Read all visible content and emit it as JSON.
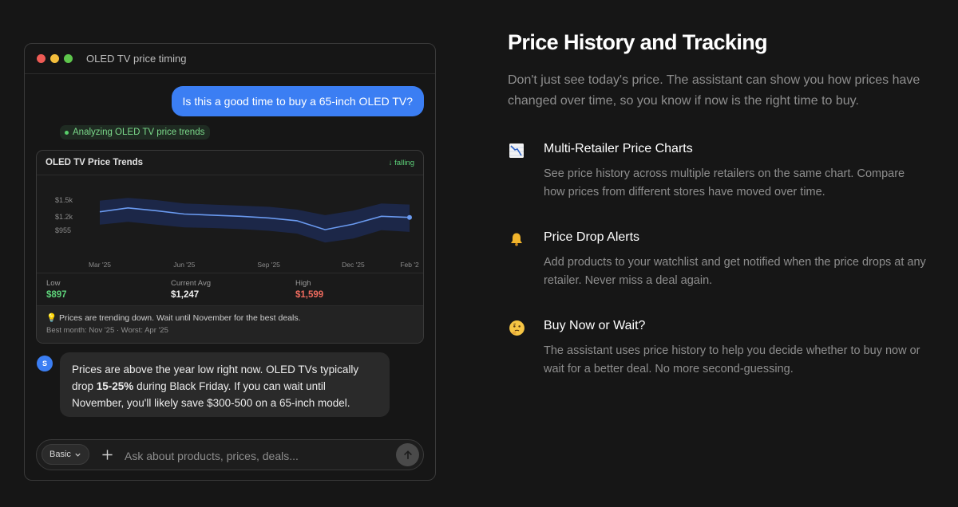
{
  "window": {
    "title": "OLED TV price timing",
    "user_message": "Is this a good time to buy a 65-inch OLED TV?",
    "status_pill": "Analyzing OLED TV price trends",
    "avatar_initial": "S",
    "bot_message": {
      "part1": "Prices are above the year low right now. OLED TVs typically drop ",
      "bold": "15-25%",
      "part2": " during Black Friday. If you can wait until November, you'll likely save $300-500 on a 65-inch model."
    },
    "composer": {
      "mode_label": "Basic",
      "placeholder": "Ask about products, prices, deals..."
    }
  },
  "chart_card": {
    "title": "OLED TV Price Trends",
    "trend_badge": "↓ falling",
    "stats": {
      "low_label": "Low",
      "low_value": "$897",
      "avg_label": "Current Avg",
      "avg_value": "$1,247",
      "high_label": "High",
      "high_value": "$1,599"
    },
    "tip": "Prices are trending down. Wait until November for the best deals.",
    "tip_sub": "Best month: Nov '25 · Worst: Apr '25",
    "tip_icon": "lightbulb-icon"
  },
  "chart_data": {
    "type": "area",
    "title": "OLED TV Price Trends",
    "x": [
      "Mar '25",
      "Apr '25",
      "May '25",
      "Jun '25",
      "Jul '25",
      "Aug '25",
      "Sep '25",
      "Oct '25",
      "Nov '25",
      "Dec '25",
      "Jan '26",
      "Feb '26"
    ],
    "x_tick_labels": [
      "Mar '25",
      "Jun '25",
      "Sep '25",
      "Dec '25",
      "Feb '2"
    ],
    "y_tick_labels": [
      "$1.5k",
      "$1.2k",
      "$955"
    ],
    "ylim": [
      700,
      1700
    ],
    "series": [
      {
        "values": [
          1290,
          1360,
          1310,
          1250,
          1230,
          1210,
          1180,
          1130,
          970,
          1070,
          1210,
          1190
        ]
      }
    ],
    "band_upper": [
      1490,
      1540,
      1500,
      1440,
      1420,
      1400,
      1380,
      1330,
      1230,
      1310,
      1440,
      1420
    ],
    "band_lower": [
      1060,
      1110,
      1060,
      1010,
      1000,
      980,
      950,
      900,
      740,
      810,
      960,
      930
    ],
    "grid": false,
    "colors": {
      "line": "#6a9af0",
      "band": "#1c2748",
      "end_dot": "#6a9af0"
    }
  },
  "panel": {
    "headline": "Price History and Tracking",
    "lead": "Don't just see today's price. The assistant can show you how prices have changed over time, so you know if now is the right time to buy.",
    "features": [
      {
        "icon": "chart-decreasing-icon",
        "title": "Multi-Retailer Price Charts",
        "desc": "See price history across multiple retailers on the same chart. Compare how prices from different stores have moved over time."
      },
      {
        "icon": "bell-icon",
        "title": "Price Drop Alerts",
        "desc": "Add products to your watchlist and get notified when the price drops at any retailer. Never miss a deal again."
      },
      {
        "icon": "thinking-face-icon",
        "title": "Buy Now or Wait?",
        "desc": "The assistant uses price history to help you decide whether to buy now or wait for a better deal. No more second-guessing."
      }
    ]
  },
  "colors": {
    "background": "#161616",
    "accent": "#3b7ef3",
    "positive": "#5dd179",
    "negative": "#ee6b5e"
  }
}
